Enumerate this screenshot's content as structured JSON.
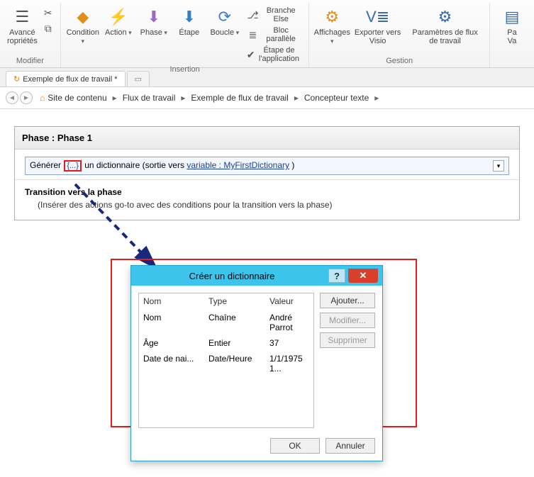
{
  "ribbon": {
    "groups": {
      "modifier": {
        "label": "Modifier",
        "advanced": "Avancé",
        "props": "ropriétés"
      },
      "insertion": {
        "label": "Insertion",
        "condition": "Condition",
        "action": "Action",
        "phase": "Phase",
        "etape": "Étape",
        "boucle": "Boucle",
        "branche": "Branche Else",
        "bloc": "Bloc parallèle",
        "app_step": "Étape de l'application"
      },
      "gestion": {
        "label": "Gestion",
        "views": "Affichages",
        "export": "Exporter vers Visio",
        "settings": "Paramètres de flux de travail"
      },
      "va": {
        "p": "Pa",
        "v": "Va"
      }
    }
  },
  "tabs": {
    "active": "Exemple de flux de travail *"
  },
  "breadcrumb": {
    "items": [
      "Site de contenu",
      "Flux de travail",
      "Exemple de flux de travail",
      "Concepteur texte"
    ]
  },
  "phase": {
    "title": "Phase : Phase 1",
    "action_prefix": "Générer",
    "action_mid": "un dictionnaire (sortie vers",
    "action_link": "variable : MyFirstDictionary",
    "action_suffix": ")",
    "transition_header": "Transition vers la phase",
    "transition_text": "(Insérer des actions go-to avec des conditions pour la transition vers la phase)"
  },
  "dialog": {
    "title": "Créer un dictionnaire",
    "columns": {
      "name": "Nom",
      "type": "Type",
      "value": "Valeur"
    },
    "rows": [
      {
        "name": "Nom",
        "type": "Chaîne",
        "value": "André Parrot"
      },
      {
        "name": "Âge",
        "type": "Entier",
        "value": "37"
      },
      {
        "name": "Date de nai...",
        "type": "Date/Heure",
        "value": "1/1/1975 1..."
      }
    ],
    "add": "Ajouter...",
    "modify": "Modifier...",
    "delete": "Supprimer",
    "ok": "OK",
    "cancel": "Annuler"
  }
}
